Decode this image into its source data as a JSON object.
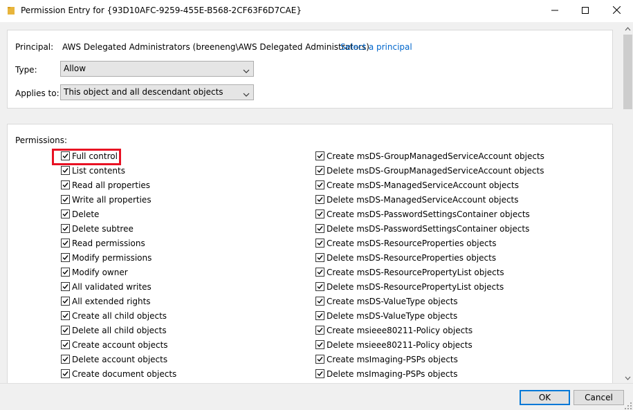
{
  "window": {
    "title": "Permission Entry for {93D10AFC-9259-455E-B568-2CF63F6D7CAE}"
  },
  "principal": {
    "label": "Principal:",
    "value": "AWS Delegated Administrators (breeneng\\AWS Delegated Administrators)",
    "link": "Select a principal"
  },
  "type": {
    "label": "Type:",
    "value": "Allow"
  },
  "applies_to": {
    "label": "Applies to:",
    "value": "This object and all descendant objects"
  },
  "permissions": {
    "label": "Permissions:",
    "left": [
      {
        "label": "Full control",
        "checked": true
      },
      {
        "label": "List contents",
        "checked": true
      },
      {
        "label": "Read all properties",
        "checked": true
      },
      {
        "label": "Write all properties",
        "checked": true
      },
      {
        "label": "Delete",
        "checked": true
      },
      {
        "label": "Delete subtree",
        "checked": true
      },
      {
        "label": "Read permissions",
        "checked": true
      },
      {
        "label": "Modify permissions",
        "checked": true
      },
      {
        "label": "Modify owner",
        "checked": true
      },
      {
        "label": "All validated writes",
        "checked": true
      },
      {
        "label": "All extended rights",
        "checked": true
      },
      {
        "label": "Create all child objects",
        "checked": true
      },
      {
        "label": "Delete all child objects",
        "checked": true
      },
      {
        "label": "Create account objects",
        "checked": true
      },
      {
        "label": "Delete account objects",
        "checked": true
      },
      {
        "label": "Create document objects",
        "checked": true
      }
    ],
    "right": [
      {
        "label": "Create msDS-GroupManagedServiceAccount objects",
        "checked": true
      },
      {
        "label": "Delete msDS-GroupManagedServiceAccount objects",
        "checked": true
      },
      {
        "label": "Create msDS-ManagedServiceAccount objects",
        "checked": true
      },
      {
        "label": "Delete msDS-ManagedServiceAccount objects",
        "checked": true
      },
      {
        "label": "Create msDS-PasswordSettingsContainer objects",
        "checked": true
      },
      {
        "label": "Delete msDS-PasswordSettingsContainer objects",
        "checked": true
      },
      {
        "label": "Create msDS-ResourceProperties objects",
        "checked": true
      },
      {
        "label": "Delete msDS-ResourceProperties objects",
        "checked": true
      },
      {
        "label": "Create msDS-ResourcePropertyList objects",
        "checked": true
      },
      {
        "label": "Delete msDS-ResourcePropertyList objects",
        "checked": true
      },
      {
        "label": "Create msDS-ValueType objects",
        "checked": true
      },
      {
        "label": "Delete msDS-ValueType objects",
        "checked": true
      },
      {
        "label": "Create msieee80211-Policy objects",
        "checked": true
      },
      {
        "label": "Delete msieee80211-Policy objects",
        "checked": true
      },
      {
        "label": "Create msImaging-PSPs objects",
        "checked": true
      },
      {
        "label": "Delete msImaging-PSPs objects",
        "checked": true
      }
    ]
  },
  "buttons": {
    "ok": "OK",
    "cancel": "Cancel"
  },
  "colors": {
    "link": "#0066cc",
    "highlight": "#e81123",
    "ok_border": "#0078d7"
  },
  "icons": {
    "title": "folder-icon",
    "minimize": "minimize-icon",
    "maximize": "maximize-icon",
    "close": "close-icon"
  }
}
